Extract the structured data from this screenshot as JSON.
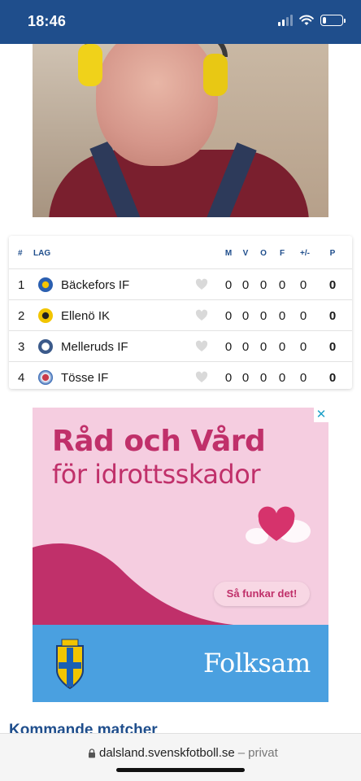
{
  "status": {
    "time": "18:46",
    "battery_level": 0.2
  },
  "hero": {
    "icon": "photo-man-with-ear-protection"
  },
  "standings": {
    "headers": {
      "rank": "#",
      "team": "LAG",
      "m": "M",
      "v": "V",
      "o": "O",
      "f": "F",
      "pm": "+/-",
      "p": "P"
    },
    "rows": [
      {
        "rank": "1",
        "team": "Bäckefors IF",
        "m": "0",
        "v": "0",
        "o": "0",
        "f": "0",
        "pm": "0",
        "p": "0",
        "logo_color": "#2a5fb0"
      },
      {
        "rank": "2",
        "team": "Ellenö IK",
        "m": "0",
        "v": "0",
        "o": "0",
        "f": "0",
        "pm": "0",
        "p": "0",
        "logo_color": "#f2c500"
      },
      {
        "rank": "3",
        "team": "Melleruds IF",
        "m": "0",
        "v": "0",
        "o": "0",
        "f": "0",
        "pm": "0",
        "p": "0",
        "logo_color": "#3b5a8a"
      },
      {
        "rank": "4",
        "team": "Tösse IF",
        "m": "0",
        "v": "0",
        "o": "0",
        "f": "0",
        "pm": "0",
        "p": "0",
        "logo_color": "#c83a4a"
      }
    ]
  },
  "ad": {
    "title": "Råd och Vård",
    "subtitle": "för idrottsskador",
    "cta": "Så funkar det!",
    "brand": "Folksam",
    "close": "✕",
    "colors": {
      "pink": "#c0306a",
      "bg": "#f5cde0",
      "footer": "#4aa0e0"
    }
  },
  "upcoming": {
    "heading": "Kommande matcher"
  },
  "browser": {
    "url": "dalsland.svenskfotboll.se",
    "separator": "–",
    "mode": "privat"
  },
  "colors": {
    "brand_blue": "#1f4e8c"
  }
}
